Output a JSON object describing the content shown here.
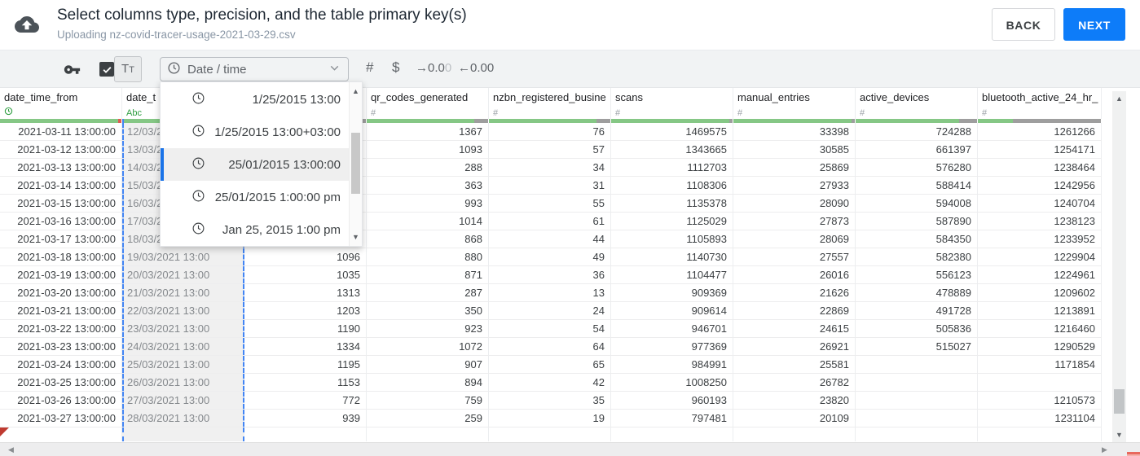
{
  "header": {
    "title": "Select columns type, precision, and the table primary key(s)",
    "subtitle": "Uploading nz-covid-tracer-usage-2021-03-29.csv",
    "back_label": "BACK",
    "next_label": "NEXT"
  },
  "toolbar": {
    "format_button_label": "Tt",
    "type_select_value": "Date / time",
    "number_icon_label": "#",
    "currency_icon_label": "$",
    "decimal_increase": {
      "arrow": "→",
      "main": "0.0",
      "faded": "0"
    },
    "decimal_decrease": {
      "arrow": "←",
      "main": "0.00"
    }
  },
  "type_menu": {
    "selected_index": 2,
    "items": [
      "1/25/2015 13:00",
      "1/25/2015 13:00+03:00",
      "25/01/2015 13:00:00",
      "25/01/2015 1:00:00 pm",
      "Jan 25, 2015 1:00 pm"
    ]
  },
  "colors": {
    "green": "#85c785",
    "gray": "#9e9e9e",
    "red": "#e05c51",
    "accent_blue": "#4285f4",
    "selection_blue": "#1a73e8",
    "next_blue": "#0d7cf9"
  },
  "table": {
    "columns": [
      {
        "name": "date_time_from",
        "type_icon": "clock",
        "align": "right",
        "bar": [
          {
            "color": "green",
            "frac": 0.97
          },
          {
            "color": "red",
            "frac": 0.03
          }
        ]
      },
      {
        "name": "date_t",
        "type_icon": "Abc",
        "align": "left",
        "selected": true,
        "bar": [
          {
            "color": "green",
            "frac": 1.0
          }
        ]
      },
      {
        "name": "",
        "type_icon": "",
        "align": "right",
        "bar": [
          {
            "color": "green",
            "frac": 0.87
          },
          {
            "color": "gray",
            "frac": 0.13
          }
        ]
      },
      {
        "name": "qr_codes_generated",
        "type_icon": "#",
        "align": "right",
        "bar": [
          {
            "color": "green",
            "frac": 0.885
          },
          {
            "color": "gray",
            "frac": 0.115
          }
        ]
      },
      {
        "name": "nzbn_registered_busine",
        "type_icon": "#",
        "align": "right",
        "bar": [
          {
            "color": "green",
            "frac": 0.885
          },
          {
            "color": "gray",
            "frac": 0.115
          }
        ]
      },
      {
        "name": "scans",
        "type_icon": "#",
        "align": "right",
        "bar": [
          {
            "color": "green",
            "frac": 0.97
          },
          {
            "color": "gray",
            "frac": 0.03
          }
        ]
      },
      {
        "name": "manual_entries",
        "type_icon": "#",
        "align": "right",
        "bar": [
          {
            "color": "green",
            "frac": 0.97
          },
          {
            "color": "gray",
            "frac": 0.03
          }
        ]
      },
      {
        "name": "active_devices",
        "type_icon": "#",
        "align": "right",
        "bar": [
          {
            "color": "green",
            "frac": 0.85
          },
          {
            "color": "gray",
            "frac": 0.15
          }
        ]
      },
      {
        "name": "bluetooth_active_24_hr_",
        "type_icon": "#",
        "align": "right",
        "bar": [
          {
            "color": "green",
            "frac": 0.285
          },
          {
            "color": "gray",
            "frac": 0.715
          }
        ]
      }
    ],
    "rows": [
      [
        "2021-03-11 13:00:00",
        "12/03/2",
        "",
        "1367",
        "76",
        "1469575",
        "33398",
        "724288",
        "1261266"
      ],
      [
        "2021-03-12 13:00:00",
        "13/03/2",
        "",
        "1093",
        "57",
        "1343665",
        "30585",
        "661397",
        "1254171"
      ],
      [
        "2021-03-13 13:00:00",
        "14/03/2",
        "",
        "288",
        "34",
        "1112703",
        "25869",
        "576280",
        "1238464"
      ],
      [
        "2021-03-14 13:00:00",
        "15/03/2",
        "",
        "363",
        "31",
        "1108306",
        "27933",
        "588414",
        "1242956"
      ],
      [
        "2021-03-15 13:00:00",
        "16/03/2",
        "",
        "993",
        "55",
        "1135378",
        "28090",
        "594008",
        "1240704"
      ],
      [
        "2021-03-16 13:00:00",
        "17/03/2",
        "",
        "1014",
        "61",
        "1125029",
        "27873",
        "587890",
        "1238123"
      ],
      [
        "2021-03-17 13:00:00",
        "18/03/2",
        "",
        "868",
        "44",
        "1105893",
        "28069",
        "584350",
        "1233952"
      ],
      [
        "2021-03-18 13:00:00",
        "19/03/2021 13:00",
        "1096",
        "880",
        "49",
        "1140730",
        "27557",
        "582380",
        "1229904"
      ],
      [
        "2021-03-19 13:00:00",
        "20/03/2021 13:00",
        "1035",
        "871",
        "36",
        "1104477",
        "26016",
        "556123",
        "1224961"
      ],
      [
        "2021-03-20 13:00:00",
        "21/03/2021 13:00",
        "1313",
        "287",
        "13",
        "909369",
        "21626",
        "478889",
        "1209602"
      ],
      [
        "2021-03-21 13:00:00",
        "22/03/2021 13:00",
        "1203",
        "350",
        "24",
        "909614",
        "22869",
        "491728",
        "1213891"
      ],
      [
        "2021-03-22 13:00:00",
        "23/03/2021 13:00",
        "1190",
        "923",
        "54",
        "946701",
        "24615",
        "505836",
        "1216460"
      ],
      [
        "2021-03-23 13:00:00",
        "24/03/2021 13:00",
        "1334",
        "1072",
        "64",
        "977369",
        "26921",
        "515027",
        "1290529"
      ],
      [
        "2021-03-24 13:00:00",
        "25/03/2021 13:00",
        "1195",
        "907",
        "65",
        "984991",
        "25581",
        "",
        "1171854"
      ],
      [
        "2021-03-25 13:00:00",
        "26/03/2021 13:00",
        "1153",
        "894",
        "42",
        "1008250",
        "26782",
        "",
        ""
      ],
      [
        "2021-03-26 13:00:00",
        "27/03/2021 13:00",
        "772",
        "759",
        "35",
        "960193",
        "23820",
        "",
        "1210573"
      ],
      [
        "2021-03-27 13:00:00",
        "28/03/2021 13:00",
        "939",
        "259",
        "19",
        "797481",
        "20109",
        "",
        "1231104"
      ]
    ],
    "partial_row": {
      "cells": [
        "",
        "",
        "",
        "",
        "",
        "",
        "",
        "",
        ""
      ],
      "error_flag": true
    }
  }
}
